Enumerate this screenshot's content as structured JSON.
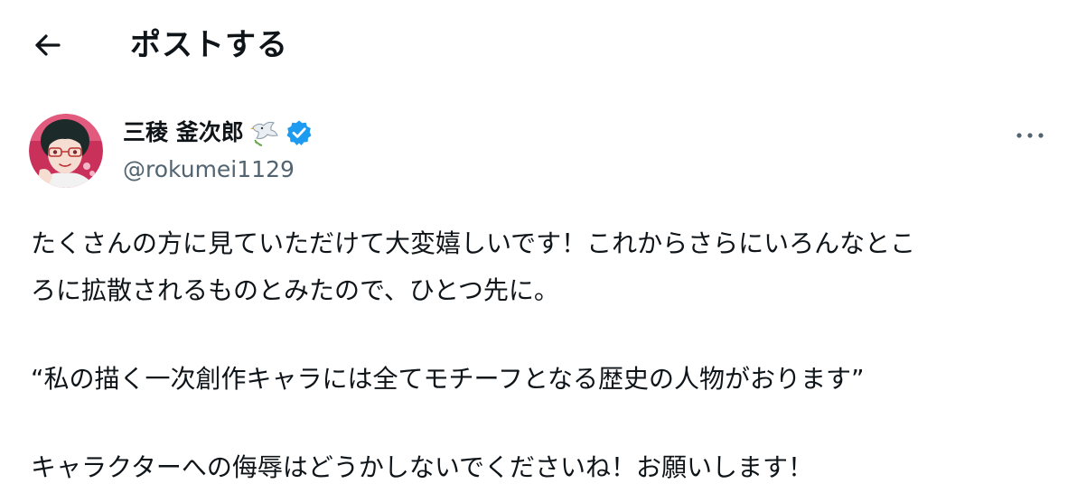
{
  "header": {
    "title": "ポストする",
    "back_icon": "arrow-left-icon"
  },
  "author": {
    "name": "三稜 釜次郎",
    "handle": "@rokumei1129",
    "name_emoji": "dove-with-olive-branch-icon",
    "verified": true,
    "verified_color": "#1d9bf0"
  },
  "more_icon": "more-horizontal-icon",
  "post": {
    "line1": "たくさんの方に見ていただけて大変嬉しいです！これからさらにいろんなとこ",
    "line2": "ろに拡散されるものとみたので、ひとつ先に。",
    "line3": "“私の描く一次創作キャラには全てモチーフとなる歴史の人物がおります”",
    "line4": "キャラクターへの侮辱はどうかしないでくださいね！お願いします！"
  }
}
